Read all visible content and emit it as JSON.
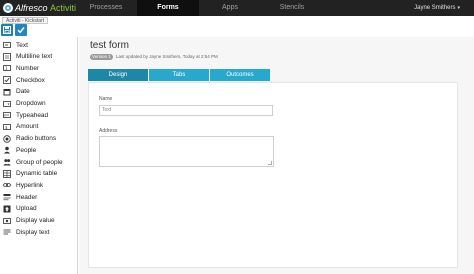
{
  "app": {
    "logo_text": "Alfresco",
    "logo_accent": "Activiti",
    "brand_color": "#5fb0dc"
  },
  "nav": {
    "items": [
      {
        "label": "Processes",
        "active": false
      },
      {
        "label": "Forms",
        "active": true
      },
      {
        "label": "Apps",
        "active": false
      },
      {
        "label": "Stencils",
        "active": false
      }
    ],
    "user": "Jayne Smithers"
  },
  "breadcrumb": {
    "label": "Activiti - Kickstart"
  },
  "toolbar": {
    "save_icon": "save-icon",
    "validate_icon": "check-icon"
  },
  "palette": {
    "items": [
      {
        "label": "Text",
        "icon": "text-field-icon"
      },
      {
        "label": "Multiline text",
        "icon": "multiline-text-icon"
      },
      {
        "label": "Number",
        "icon": "number-icon"
      },
      {
        "label": "Checkbox",
        "icon": "checkbox-icon"
      },
      {
        "label": "Date",
        "icon": "calendar-icon"
      },
      {
        "label": "Dropdown",
        "icon": "dropdown-icon"
      },
      {
        "label": "Typeahead",
        "icon": "typeahead-icon"
      },
      {
        "label": "Amount",
        "icon": "amount-icon"
      },
      {
        "label": "Radio buttons",
        "icon": "radio-icon"
      },
      {
        "label": "People",
        "icon": "person-icon"
      },
      {
        "label": "Group of people",
        "icon": "group-icon"
      },
      {
        "label": "Dynamic table",
        "icon": "table-icon"
      },
      {
        "label": "Hyperlink",
        "icon": "link-icon"
      },
      {
        "label": "Header",
        "icon": "header-icon"
      },
      {
        "label": "Upload",
        "icon": "upload-icon"
      },
      {
        "label": "Display value",
        "icon": "display-value-icon"
      },
      {
        "label": "Display text",
        "icon": "display-text-icon"
      }
    ]
  },
  "form": {
    "title": "test form",
    "version": "Version 1",
    "updated": "Last updated by Jayne Smithers, Today at 2:54 PM",
    "tabs": [
      {
        "label": "Design",
        "active": true
      },
      {
        "label": "Tabs",
        "active": false
      },
      {
        "label": "Outcomes",
        "active": false
      }
    ],
    "fields": {
      "name_label": "Name",
      "name_placeholder": "Text",
      "address_label": "Address"
    }
  }
}
